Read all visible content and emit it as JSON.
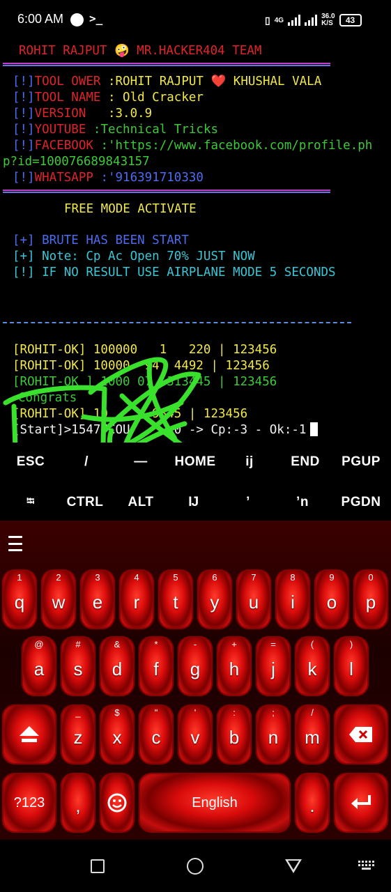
{
  "status_bar": {
    "time": "6:00 AM",
    "terminal_glyph": ">_",
    "network": "4G",
    "speed_value": "36.0",
    "speed_unit": "K/S",
    "battery": "43"
  },
  "terminal": {
    "banner": "ROHIT RAJPUT 🤪 MR.HACKER404 TEAM",
    "info": [
      {
        "tag": "[!]",
        "key": "TOOL OWER ",
        "value": ":ROHIT RAJPUT ❤️ KHUSHAL VALA"
      },
      {
        "tag": "[!]",
        "key": "TOOL NAME ",
        "value": ": Old Cracker"
      },
      {
        "tag": "[!]",
        "key": "VERSION   ",
        "value": ":3.0.9"
      },
      {
        "tag": "[!]",
        "key": "YOUTUBE ",
        "value": ":Technical Tricks"
      },
      {
        "tag": "[!]",
        "key": "FACEBOOK ",
        "value": ":'https://www.facebook.com/profile.ph"
      },
      {
        "tag": "",
        "key": "",
        "value": "p?id=100076689843157"
      },
      {
        "tag": "[!]",
        "key": "WHATSAPP ",
        "value": ":'916391710330"
      }
    ],
    "mode": "FREE MODE ACTIVATE",
    "messages": [
      "[+] BRUTE HAS BEEN START",
      "[+] Note: Cp Ac Open 70% JUST NOW",
      "[!] IF NO RESULT USE AIRPLANE MODE 5 SECONDS"
    ],
    "results": [
      "[ROHIT-OK] 100000   1   220 | 123456",
      "[ROHIT-OK] 10000  94  4492 | 123456",
      "[ROHIT-OK ] 1000 07  313445 | 123456",
      "Congrats",
      "[ROHIT-OK] 10      9845 | 123456"
    ],
    "progress": "[Start]>1547/COU      0 -> Cp:-3 - Ok:-1"
  },
  "extra_keys": {
    "row1": [
      "ESC",
      "/",
      "—",
      "HOME",
      "ij",
      "END",
      "PGUP"
    ],
    "row2": [
      "⭾",
      "CTRL",
      "ALT",
      "Ĳ",
      "’",
      "ʼn",
      "PGDN"
    ]
  },
  "keyboard": {
    "row1": [
      {
        "k": "q",
        "h": "1"
      },
      {
        "k": "w",
        "h": "2"
      },
      {
        "k": "e",
        "h": "3"
      },
      {
        "k": "r",
        "h": "4"
      },
      {
        "k": "t",
        "h": "5"
      },
      {
        "k": "y",
        "h": "6"
      },
      {
        "k": "u",
        "h": "7"
      },
      {
        "k": "i",
        "h": "8"
      },
      {
        "k": "o",
        "h": "9"
      },
      {
        "k": "p",
        "h": "0"
      }
    ],
    "row2": [
      {
        "k": "a",
        "h": "@"
      },
      {
        "k": "s",
        "h": "#"
      },
      {
        "k": "d",
        "h": "&"
      },
      {
        "k": "f",
        "h": "*"
      },
      {
        "k": "g",
        "h": "-"
      },
      {
        "k": "h",
        "h": "+"
      },
      {
        "k": "j",
        "h": "="
      },
      {
        "k": "k",
        "h": "("
      },
      {
        "k": "l",
        "h": ")"
      }
    ],
    "row3": [
      {
        "k": "z",
        "h": "_"
      },
      {
        "k": "x",
        "h": "$"
      },
      {
        "k": "c",
        "h": "\""
      },
      {
        "k": "v",
        "h": "'"
      },
      {
        "k": "b",
        "h": ":"
      },
      {
        "k": "n",
        "h": ";"
      },
      {
        "k": "m",
        "h": "/"
      }
    ],
    "symbols": "?123",
    "comma": ",",
    "space": "English",
    "period": "."
  }
}
